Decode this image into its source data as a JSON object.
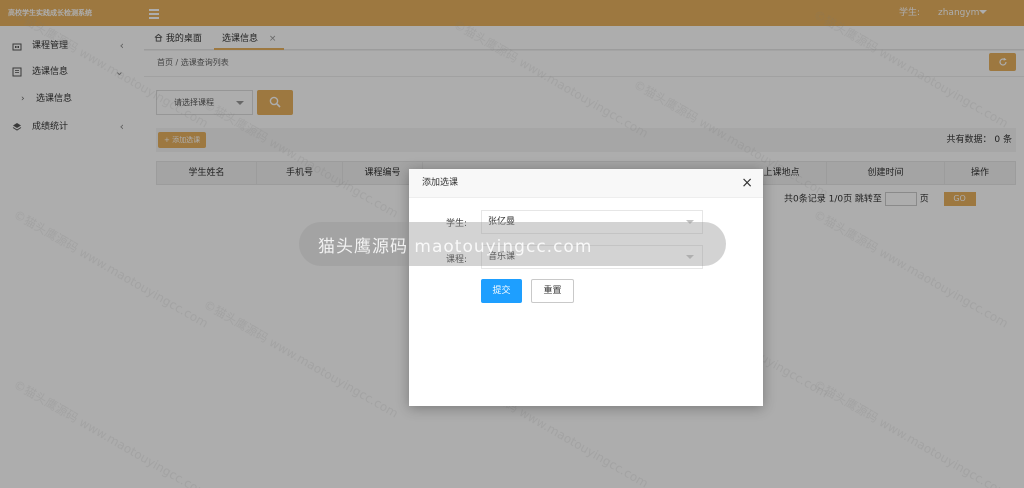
{
  "app": {
    "title": "高校学生实践成长检测系统",
    "user_role": "学生:",
    "username": "zhangym"
  },
  "sidebar": {
    "items": [
      {
        "label": "课程管理",
        "icon": "building-icon",
        "arrow": "‹"
      },
      {
        "label": "选课信息",
        "icon": "book-icon",
        "arrow": "⌄"
      },
      {
        "label": "成绩统计",
        "icon": "layers-icon",
        "arrow": "‹"
      }
    ],
    "sub_items": [
      {
        "label": "选课信息",
        "bullet": "›"
      }
    ]
  },
  "tabs": [
    {
      "label": "我的桌面",
      "icon": "home-icon"
    },
    {
      "label": "选课信息",
      "close": "×"
    }
  ],
  "breadcrumb": "首页  /  选课查询列表",
  "filters": {
    "course_select_placeholder": "请选择课程"
  },
  "toolbar": {
    "add_label": "+ 添加选课",
    "total_text": "共有数据： 0 条"
  },
  "table": {
    "columns": [
      "学生姓名",
      "手机号",
      "课程编号",
      "上课地点",
      "创建时间",
      "操作"
    ]
  },
  "pagination": {
    "summary": "共0条记录  1/0页  跳转至",
    "page_suffix": "页",
    "go_label": "GO"
  },
  "modal": {
    "title": "添加选课",
    "close": "×",
    "student_label": "学生:",
    "student_value": "张亿曼",
    "course_label": "课程:",
    "course_value": "音乐课",
    "submit_label": "提交",
    "reset_label": "重置"
  },
  "watermark": {
    "main_text": "猫头鹰源码 maotouyingcc.com",
    "tile_text": "©猫头鹰源码 www.maotouyingcc.com"
  },
  "colors": {
    "brand": "#e8b15f",
    "primary_button": "#1e9fff"
  }
}
